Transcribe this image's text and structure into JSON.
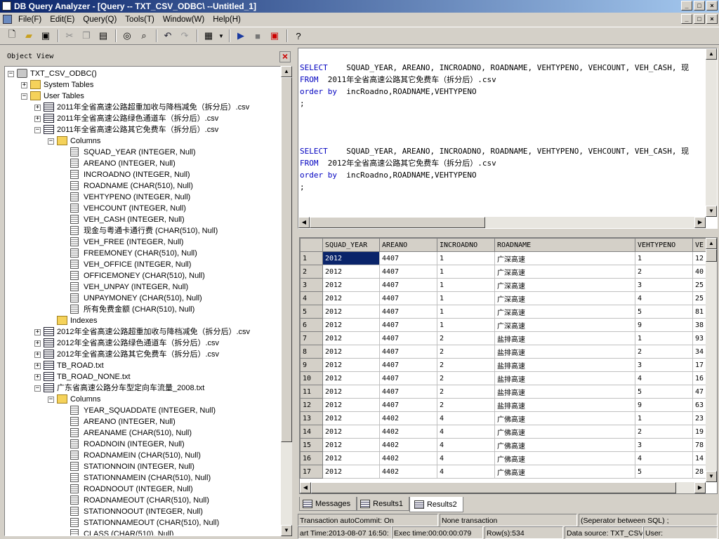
{
  "window": {
    "title": "DB Query Analyzer - [Query -- TXT_CSV_ODBC\\ --Untitled_1]"
  },
  "menu": [
    "File(F)",
    "Edit(E)",
    "Query(Q)",
    "Tools(T)",
    "Window(W)",
    "Help(H)"
  ],
  "toolbar": {
    "icons": [
      "new-file-icon",
      "open-folder-icon",
      "save-icon",
      "cut-icon",
      "copy-icon",
      "paste-icon",
      "find-icon",
      "find-replace-icon",
      "undo-icon",
      "redo-icon",
      "results-grid-icon",
      "execute-icon",
      "stop-icon",
      "cancel-icon",
      "help-icon"
    ]
  },
  "object_view": {
    "title": "Object View",
    "nodes": [
      {
        "level": 0,
        "icon": "db",
        "expand": "-",
        "label": "TXT_CSV_ODBC()"
      },
      {
        "level": 1,
        "icon": "folder",
        "expand": "+",
        "label": "System Tables"
      },
      {
        "level": 1,
        "icon": "folder",
        "expand": "-",
        "label": "User Tables"
      },
      {
        "level": 2,
        "icon": "table",
        "expand": "+",
        "label": "2011年全省高速公路超重加收与降档减免（拆分后）.csv"
      },
      {
        "level": 2,
        "icon": "table",
        "expand": "+",
        "label": "2011年全省高速公路绿色通道车（拆分后）.csv"
      },
      {
        "level": 2,
        "icon": "table",
        "expand": "-",
        "label": "2011年全省高速公路其它免费车（拆分后）.csv"
      },
      {
        "level": 3,
        "icon": "folder",
        "expand": "-",
        "label": "Columns"
      },
      {
        "level": 4,
        "icon": "col",
        "label": "SQUAD_YEAR (INTEGER, Null)"
      },
      {
        "level": 4,
        "icon": "col",
        "label": "AREANO (INTEGER, Null)"
      },
      {
        "level": 4,
        "icon": "col",
        "label": "INCROADNO (INTEGER, Null)"
      },
      {
        "level": 4,
        "icon": "col",
        "label": "ROADNAME (CHAR(510), Null)"
      },
      {
        "level": 4,
        "icon": "col",
        "label": "VEHTYPENO (INTEGER, Null)"
      },
      {
        "level": 4,
        "icon": "col",
        "label": "VEHCOUNT (INTEGER, Null)"
      },
      {
        "level": 4,
        "icon": "col",
        "label": "VEH_CASH (INTEGER, Null)"
      },
      {
        "level": 4,
        "icon": "col",
        "label": "现金与粤通卡通行费 (CHAR(510), Null)"
      },
      {
        "level": 4,
        "icon": "col",
        "label": "VEH_FREE (INTEGER, Null)"
      },
      {
        "level": 4,
        "icon": "col",
        "label": "FREEMONEY (CHAR(510), Null)"
      },
      {
        "level": 4,
        "icon": "col",
        "label": "VEH_OFFICE (INTEGER, Null)"
      },
      {
        "level": 4,
        "icon": "col",
        "label": "OFFICEMONEY (CHAR(510), Null)"
      },
      {
        "level": 4,
        "icon": "col",
        "label": "VEH_UNPAY (INTEGER, Null)"
      },
      {
        "level": 4,
        "icon": "col",
        "label": "UNPAYMONEY (CHAR(510), Null)"
      },
      {
        "level": 4,
        "icon": "col",
        "label": "所有免费金额 (CHAR(510), Null)"
      },
      {
        "level": 3,
        "icon": "folder",
        "label": "Indexes"
      },
      {
        "level": 2,
        "icon": "table",
        "expand": "+",
        "label": "2012年全省高速公路超重加收与降档减免（拆分后）.csv"
      },
      {
        "level": 2,
        "icon": "table",
        "expand": "+",
        "label": "2012年全省高速公路绿色通道车（拆分后）.csv"
      },
      {
        "level": 2,
        "icon": "table",
        "expand": "+",
        "label": "2012年全省高速公路其它免费车（拆分后）.csv"
      },
      {
        "level": 2,
        "icon": "table",
        "expand": "+",
        "label": "TB_ROAD.txt"
      },
      {
        "level": 2,
        "icon": "table",
        "expand": "+",
        "label": "TB_ROAD_NONE.txt"
      },
      {
        "level": 2,
        "icon": "table",
        "expand": "-",
        "label": "广东省高速公路分车型定向车流量_2008.txt"
      },
      {
        "level": 3,
        "icon": "folder",
        "expand": "-",
        "label": "Columns"
      },
      {
        "level": 4,
        "icon": "col",
        "label": "YEAR_SQUADDATE (INTEGER, Null)"
      },
      {
        "level": 4,
        "icon": "col",
        "label": "AREANO (INTEGER, Null)"
      },
      {
        "level": 4,
        "icon": "col",
        "label": "AREANAME (CHAR(510), Null)"
      },
      {
        "level": 4,
        "icon": "col",
        "label": "ROADNOIN (INTEGER, Null)"
      },
      {
        "level": 4,
        "icon": "col",
        "label": "ROADNAMEIN (CHAR(510), Null)"
      },
      {
        "level": 4,
        "icon": "col",
        "label": "STATIONNOIN (INTEGER, Null)"
      },
      {
        "level": 4,
        "icon": "col",
        "label": "STATIONNAMEIN (CHAR(510), Null)"
      },
      {
        "level": 4,
        "icon": "col",
        "label": "ROADNOOUT (INTEGER, Null)"
      },
      {
        "level": 4,
        "icon": "col",
        "label": "ROADNAMEOUT (CHAR(510), Null)"
      },
      {
        "level": 4,
        "icon": "col",
        "label": "STATIONNOOUT (INTEGER, Null)"
      },
      {
        "level": 4,
        "icon": "col",
        "label": "STATIONNAMEOUT (CHAR(510), Null)"
      },
      {
        "level": 4,
        "icon": "col",
        "label": "CLASS (CHAR(510), Null)"
      }
    ]
  },
  "editor": {
    "lines": [
      {
        "kw": "",
        "text": ""
      },
      {
        "kw": "SELECT",
        "text": "    SQUAD_YEAR, AREANO, INCROADNO, ROADNAME, VEHTYPENO, VEHCOUNT, VEH_CASH, 现"
      },
      {
        "kw": "FROM",
        "text": "  2011年全省高速公路其它免费车（拆分后）.csv"
      },
      {
        "kw": "order by",
        "text": "  incRoadno,ROADNAME,VEHTYPENO"
      },
      {
        "kw": "",
        "text": ";"
      },
      {
        "kw": "",
        "text": ""
      },
      {
        "kw": "",
        "text": ""
      },
      {
        "kw": "",
        "text": ""
      },
      {
        "kw": "SELECT",
        "text": "    SQUAD_YEAR, AREANO, INCROADNO, ROADNAME, VEHTYPENO, VEHCOUNT, VEH_CASH, 现"
      },
      {
        "kw": "FROM",
        "text": "  2012年全省高速公路其它免费车（拆分后）.csv"
      },
      {
        "kw": "order by",
        "text": "  incRoadno,ROADNAME,VEHTYPENO"
      },
      {
        "kw": "",
        "text": ";"
      }
    ]
  },
  "results": {
    "columns": [
      "SQUAD_YEAR",
      "AREANO",
      "INCROADNO",
      "ROADNAME",
      "VEHTYPENO",
      "VE"
    ],
    "rows": [
      [
        "1",
        "2012",
        "4407",
        "1",
        "广深高速",
        "1",
        "12"
      ],
      [
        "2",
        "2012",
        "4407",
        "1",
        "广深高速",
        "2",
        "40"
      ],
      [
        "3",
        "2012",
        "4407",
        "1",
        "广深高速",
        "3",
        "25"
      ],
      [
        "4",
        "2012",
        "4407",
        "1",
        "广深高速",
        "4",
        "25"
      ],
      [
        "5",
        "2012",
        "4407",
        "1",
        "广深高速",
        "5",
        "81"
      ],
      [
        "6",
        "2012",
        "4407",
        "1",
        "广深高速",
        "9",
        "38"
      ],
      [
        "7",
        "2012",
        "4407",
        "2",
        "盐排高速",
        "1",
        "93"
      ],
      [
        "8",
        "2012",
        "4407",
        "2",
        "盐排高速",
        "2",
        "34"
      ],
      [
        "9",
        "2012",
        "4407",
        "2",
        "盐排高速",
        "3",
        "17"
      ],
      [
        "10",
        "2012",
        "4407",
        "2",
        "盐排高速",
        "4",
        "16"
      ],
      [
        "11",
        "2012",
        "4407",
        "2",
        "盐排高速",
        "5",
        "47"
      ],
      [
        "12",
        "2012",
        "4407",
        "2",
        "盐排高速",
        "9",
        "63"
      ],
      [
        "13",
        "2012",
        "4402",
        "4",
        "广佛高速",
        "1",
        "23"
      ],
      [
        "14",
        "2012",
        "4402",
        "4",
        "广佛高速",
        "2",
        "19"
      ],
      [
        "15",
        "2012",
        "4402",
        "4",
        "广佛高速",
        "3",
        "78"
      ],
      [
        "16",
        "2012",
        "4402",
        "4",
        "广佛高速",
        "4",
        "14"
      ],
      [
        "17",
        "2012",
        "4402",
        "4",
        "广佛高速",
        "5",
        "28"
      ]
    ]
  },
  "tabs": [
    "Messages",
    "Results1",
    "Results2"
  ],
  "status": {
    "commit": "Transaction autoCommit: On",
    "transaction": "None transaction",
    "separator": "(Seperator between SQL)  ;",
    "start_time": "art Time:2013-08-07 16:50:",
    "exec_time": "Exec time:00:00:00:079",
    "rows": "Row(s):534",
    "data_source": "Data source: TXT_CSV",
    "user": "User:"
  }
}
